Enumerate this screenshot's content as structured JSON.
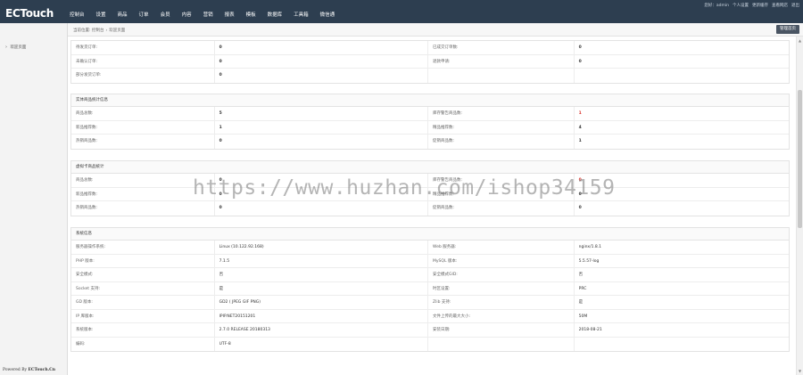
{
  "header": {
    "logo": "ECTouch",
    "nav": [
      "控制台",
      "设置",
      "商品",
      "订单",
      "会员",
      "内容",
      "营销",
      "报表",
      "模板",
      "数据库",
      "工具箱",
      "微信通"
    ],
    "user_links": [
      "您好：admin",
      "个人设置",
      "更新缓存",
      "查看网店",
      "退出"
    ]
  },
  "sidebar": {
    "item": "欢迎页面",
    "powered_prefix": "Powered By ",
    "powered_brand": "ECTouch.Cn"
  },
  "breadcrumb": {
    "label": "当前位置:",
    "level1": "控制台",
    "level2": "欢迎页面",
    "button": "管理首页"
  },
  "order_stats": {
    "rows": [
      [
        "待发货订单:",
        "0",
        "已成交订单数:",
        "0"
      ],
      [
        "未确认订单:",
        "0",
        "退款申请:",
        "0"
      ],
      [
        "部分发货订单:",
        "0",
        "",
        ""
      ]
    ]
  },
  "goods_stats": {
    "title": "实体商品统计信息",
    "rows": [
      [
        "商品总数:",
        "5",
        "库存警告商品数:",
        "1"
      ],
      [
        "新品推荐数:",
        "1",
        "精品推荐数:",
        "4"
      ],
      [
        "热销商品数:",
        "0",
        "促销商品数:",
        "1"
      ]
    ]
  },
  "virtual_stats": {
    "title": "虚拟卡商品统计",
    "rows": [
      [
        "商品总数:",
        "0",
        "库存警告商品数:",
        "0"
      ],
      [
        "新品推荐数:",
        "0",
        "精品推荐数:",
        "0"
      ],
      [
        "热销商品数:",
        "0",
        "促销商品数:",
        "0"
      ]
    ]
  },
  "system_info": {
    "title": "系统信息",
    "rows": [
      [
        "服务器操作系统:",
        "Linux (10.122.92.168)",
        "Web 服务器:",
        "nginx/1.8.1"
      ],
      [
        "PHP 版本:",
        "7.1.5",
        "MySQL 版本:",
        "5.5.57-log"
      ],
      [
        "安全模式:",
        "否",
        "安全模式GID:",
        "否"
      ],
      [
        "Socket 支持:",
        "是",
        "时区设置:",
        "PRC"
      ],
      [
        "GD 版本:",
        "GD2 ( JPEG GIF PNG)",
        "Zlib 支持:",
        "是"
      ],
      [
        "IP 库版本:",
        "IPIP.NET20151201",
        "文件上传的最大大小:",
        "50M"
      ],
      [
        "系统版本:",
        "2.7.0 RELEASE 20180313",
        "安装日期:",
        "2018-08-21"
      ],
      [
        "编码:",
        "UTF-8",
        "",
        ""
      ]
    ]
  },
  "watermark": "https://www.huzhan.com/ishop34159",
  "colors": {
    "topbar": "#2d3e50",
    "warning": "#d9322b"
  },
  "icons": {
    "scroll_up": "triangle-up",
    "scroll_down": "triangle-down",
    "sidebar_bullet": "chevron-right"
  }
}
